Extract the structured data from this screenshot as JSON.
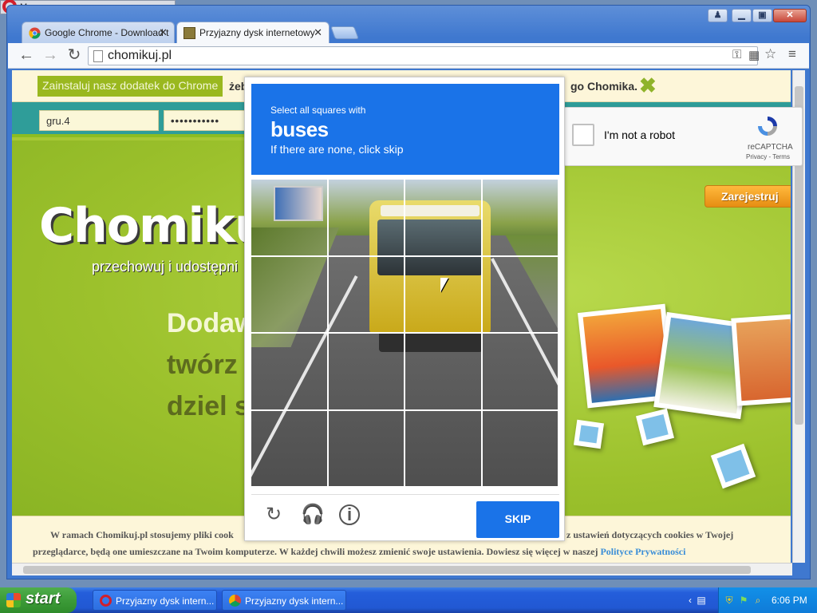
{
  "behind_window": {
    "title": "Menu"
  },
  "browser": {
    "tabs": [
      {
        "label": "Google Chrome - Download t",
        "active": false
      },
      {
        "label": "Przyjazny dysk internetowy",
        "active": true
      }
    ],
    "url": "chomikuj.pl",
    "window_controls": {
      "user": "♟",
      "minimize": "▁",
      "maximize": "▣",
      "close": "✕"
    }
  },
  "page": {
    "infobar": {
      "install_button": "Zainstaluj nasz dodatek do Chrome",
      "text_left": "żeb",
      "text_right": "go Chomika.",
      "close": "✖"
    },
    "login": {
      "username": "gru.4",
      "password": "•••••••••••"
    },
    "hero": {
      "logo": "Chomikuj.",
      "tagline": "przechowuj i udostępni",
      "line1": "Dodaw",
      "line2": "twórz",
      "line3": "dziel s",
      "register": "Zarejestruj"
    },
    "cookie": {
      "line1a": "W ramach Chomikuj.pl stosujemy pliki cook",
      "line1b": "z ustawień dotyczących cookies w Twojej",
      "line2": "przeglądarce, będą one umieszczane na Twoim komputerze. W każdej chwili możesz zmienić swoje ustawienia. Dowiesz się więcej w naszej",
      "link": "Polityce Prywatności"
    }
  },
  "recaptcha_widget": {
    "label": "I'm not a robot",
    "brand": "reCAPTCHA",
    "terms": "Privacy - Terms"
  },
  "recaptcha_challenge": {
    "instruction_small": "Select all squares with",
    "target": "buses",
    "instruction_sub": "If there are none, click skip",
    "grid_size": 4,
    "skip_label": "SKIP",
    "colors": {
      "header": "#1a73e8",
      "button": "#1a73e8"
    }
  },
  "taskbar": {
    "start": "start",
    "tasks": [
      {
        "label": "Przyjazny dysk intern...",
        "icon": "opera-icon"
      },
      {
        "label": "Przyjazny dysk intern...",
        "icon": "chrome-icon"
      }
    ],
    "clock": "6:06 PM"
  }
}
